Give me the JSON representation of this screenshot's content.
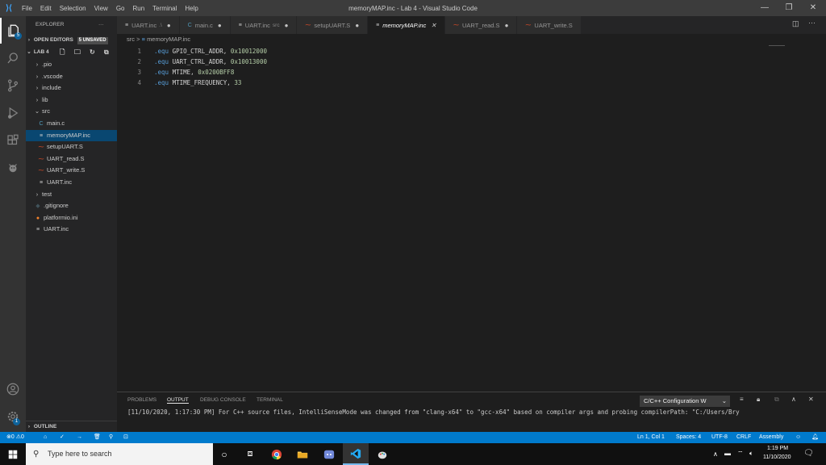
{
  "window": {
    "title": "memoryMAP.inc - Lab 4 - Visual Studio Code",
    "menu": [
      "File",
      "Edit",
      "Selection",
      "View",
      "Go",
      "Run",
      "Terminal",
      "Help"
    ],
    "controls": [
      "—",
      "❐",
      "✕"
    ]
  },
  "activitybar": {
    "icons": [
      "explorer-icon",
      "search-icon",
      "source-control-icon",
      "run-debug-icon",
      "extensions-icon",
      "platformio-icon",
      "accounts-icon",
      "settings-gear-icon"
    ],
    "explorer_badge": "5",
    "settings_badge": "1"
  },
  "sidebar": {
    "header": "EXPLORER",
    "more": "···",
    "open_editors": "OPEN EDITORS",
    "unsaved_badge": "5 UNSAVED",
    "project": "LAB 4",
    "tree": [
      {
        "label": ".pio",
        "kind": "folder",
        "expanded": false,
        "indent": 1
      },
      {
        "label": ".vscode",
        "kind": "folder",
        "expanded": false,
        "indent": 1
      },
      {
        "label": "include",
        "kind": "folder",
        "expanded": false,
        "indent": 1
      },
      {
        "label": "lib",
        "kind": "folder",
        "expanded": false,
        "indent": 1
      },
      {
        "label": "src",
        "kind": "folder",
        "expanded": true,
        "indent": 1
      },
      {
        "label": "main.c",
        "kind": "c",
        "indent": 2
      },
      {
        "label": "memoryMAP.inc",
        "kind": "inc",
        "indent": 2,
        "selected": true
      },
      {
        "label": "setupUART.S",
        "kind": "asm",
        "indent": 2
      },
      {
        "label": "UART_read.S",
        "kind": "asm",
        "indent": 2
      },
      {
        "label": "UART_write.S",
        "kind": "asm",
        "indent": 2
      },
      {
        "label": "UART.inc",
        "kind": "inc",
        "indent": 2
      },
      {
        "label": "test",
        "kind": "folder",
        "expanded": false,
        "indent": 1
      },
      {
        "label": ".gitignore",
        "kind": "git",
        "indent": 1
      },
      {
        "label": "platformio.ini",
        "kind": "pio",
        "indent": 1
      },
      {
        "label": "UART.inc",
        "kind": "inc",
        "indent": 1
      }
    ],
    "outline": "OUTLINE"
  },
  "tabs": [
    {
      "label": "UART.inc",
      "sub": ".\\",
      "icon": "≡",
      "state": "dot"
    },
    {
      "label": "main.c",
      "sub": "",
      "icon": "C",
      "state": "dot"
    },
    {
      "label": "UART.inc",
      "sub": "src",
      "icon": "≡",
      "state": "dot"
    },
    {
      "label": "setupUART.S",
      "sub": "",
      "icon": "asm",
      "state": "dot"
    },
    {
      "label": "memoryMAP.inc",
      "sub": "",
      "icon": "≡",
      "state": "close",
      "active": true
    },
    {
      "label": "UART_read.S",
      "sub": "",
      "icon": "asm",
      "state": "dot"
    },
    {
      "label": "UART_write.S",
      "sub": "",
      "icon": "asm",
      "state": "none"
    }
  ],
  "breadcrumb": {
    "folder": "src",
    "sep": ">",
    "file": "memoryMAP.inc"
  },
  "editor": {
    "lines": [
      {
        "n": "1",
        "kw": ".equ",
        "name": "GPIO_CTRL_ADDR,",
        "val": "0x10012000"
      },
      {
        "n": "2",
        "kw": ".equ",
        "name": "UART_CTRL_ADDR,",
        "val": "0x10013000"
      },
      {
        "n": "3",
        "kw": ".equ",
        "name": "MTIME,",
        "val": "0x0200BFF8"
      },
      {
        "n": "4",
        "kw": ".equ",
        "name": "MTIME_FREQUENCY,",
        "val": "33"
      }
    ]
  },
  "panel": {
    "tabs": [
      "PROBLEMS",
      "OUTPUT",
      "DEBUG CONSOLE",
      "TERMINAL"
    ],
    "active_tab": "OUTPUT",
    "channel": "C/C++ Configuration W",
    "output_text": "[11/10/2020, 1:17:30 PM] For C++ source files, IntelliSenseMode was changed from \"clang-x64\" to \"gcc-x64\" based on compiler args and probing compilerPath: \"C:/Users/Bry"
  },
  "statusbar": {
    "errors": "0",
    "warnings": "0",
    "cursor": "Ln 1, Col 1",
    "spaces": "Spaces: 4",
    "encoding": "UTF-8",
    "eol": "CRLF",
    "language": "Assembly"
  },
  "taskbar": {
    "search_placeholder": "Type here to search",
    "time": "1:19 PM",
    "date": "11/10/2020"
  },
  "colors": {
    "accent": "#007acc",
    "selection": "#094771",
    "activity_bar": "#333333",
    "sidebar": "#252526",
    "editor_bg": "#1e1e1e"
  }
}
